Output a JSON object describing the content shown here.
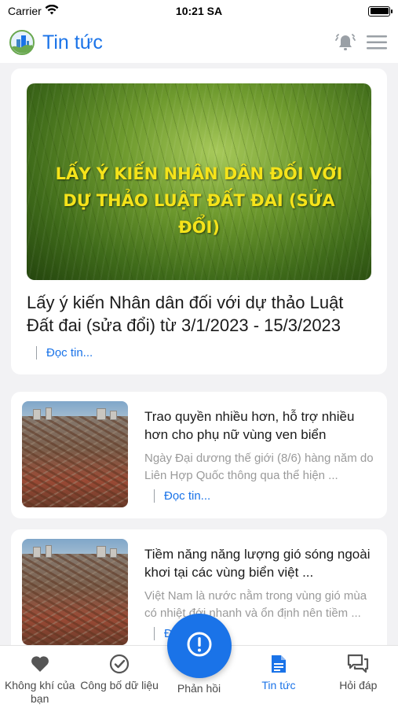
{
  "status_bar": {
    "carrier": "Carrier",
    "time": "10:21 SA"
  },
  "header": {
    "title": "Tin tức"
  },
  "featured": {
    "image_text": "LẤY Ý KIẾN NHÂN DÂN ĐỐI VỚI DỰ THẢO LUẬT ĐẤT ĐAI (SỬA ĐỔI)",
    "title": "Lấy ý kiến Nhân dân đối với dự thảo Luật Đất đai (sửa đổi) từ 3/1/2023 - 15/3/2023",
    "read_more": "Đọc tin..."
  },
  "news": [
    {
      "title": "Trao quyền nhiều hơn, hỗ trợ nhiều hơn cho phụ nữ vùng ven biển",
      "description": "Ngày Đại dương thế giới (8/6) hàng năm do Liên Hợp Quốc thông qua thể hiện ...",
      "read_more": "Đọc tin..."
    },
    {
      "title": "Tiềm năng năng lượng gió sóng ngoài khơi tại các vùng biển việt ...",
      "description": "Việt Nam là nước nằm trong vùng gió mùa có nhiệt đới nhanh và ổn định nên tiềm ...",
      "read_more": "Đọc tin..."
    }
  ],
  "tabs": [
    {
      "label": "Không khí của bạn",
      "icon": "heart-icon"
    },
    {
      "label": "Công bố dữ liệu",
      "icon": "check-circle-icon"
    },
    {
      "label": "Phản hồi",
      "icon": "alert-circle-icon"
    },
    {
      "label": "Tin tức",
      "icon": "document-icon",
      "active": true
    },
    {
      "label": "Hỏi đáp",
      "icon": "chat-icon"
    }
  ],
  "colors": {
    "accent": "#1a73e8",
    "banner_text": "#f5e31a",
    "muted_text": "#9a9a9a"
  }
}
